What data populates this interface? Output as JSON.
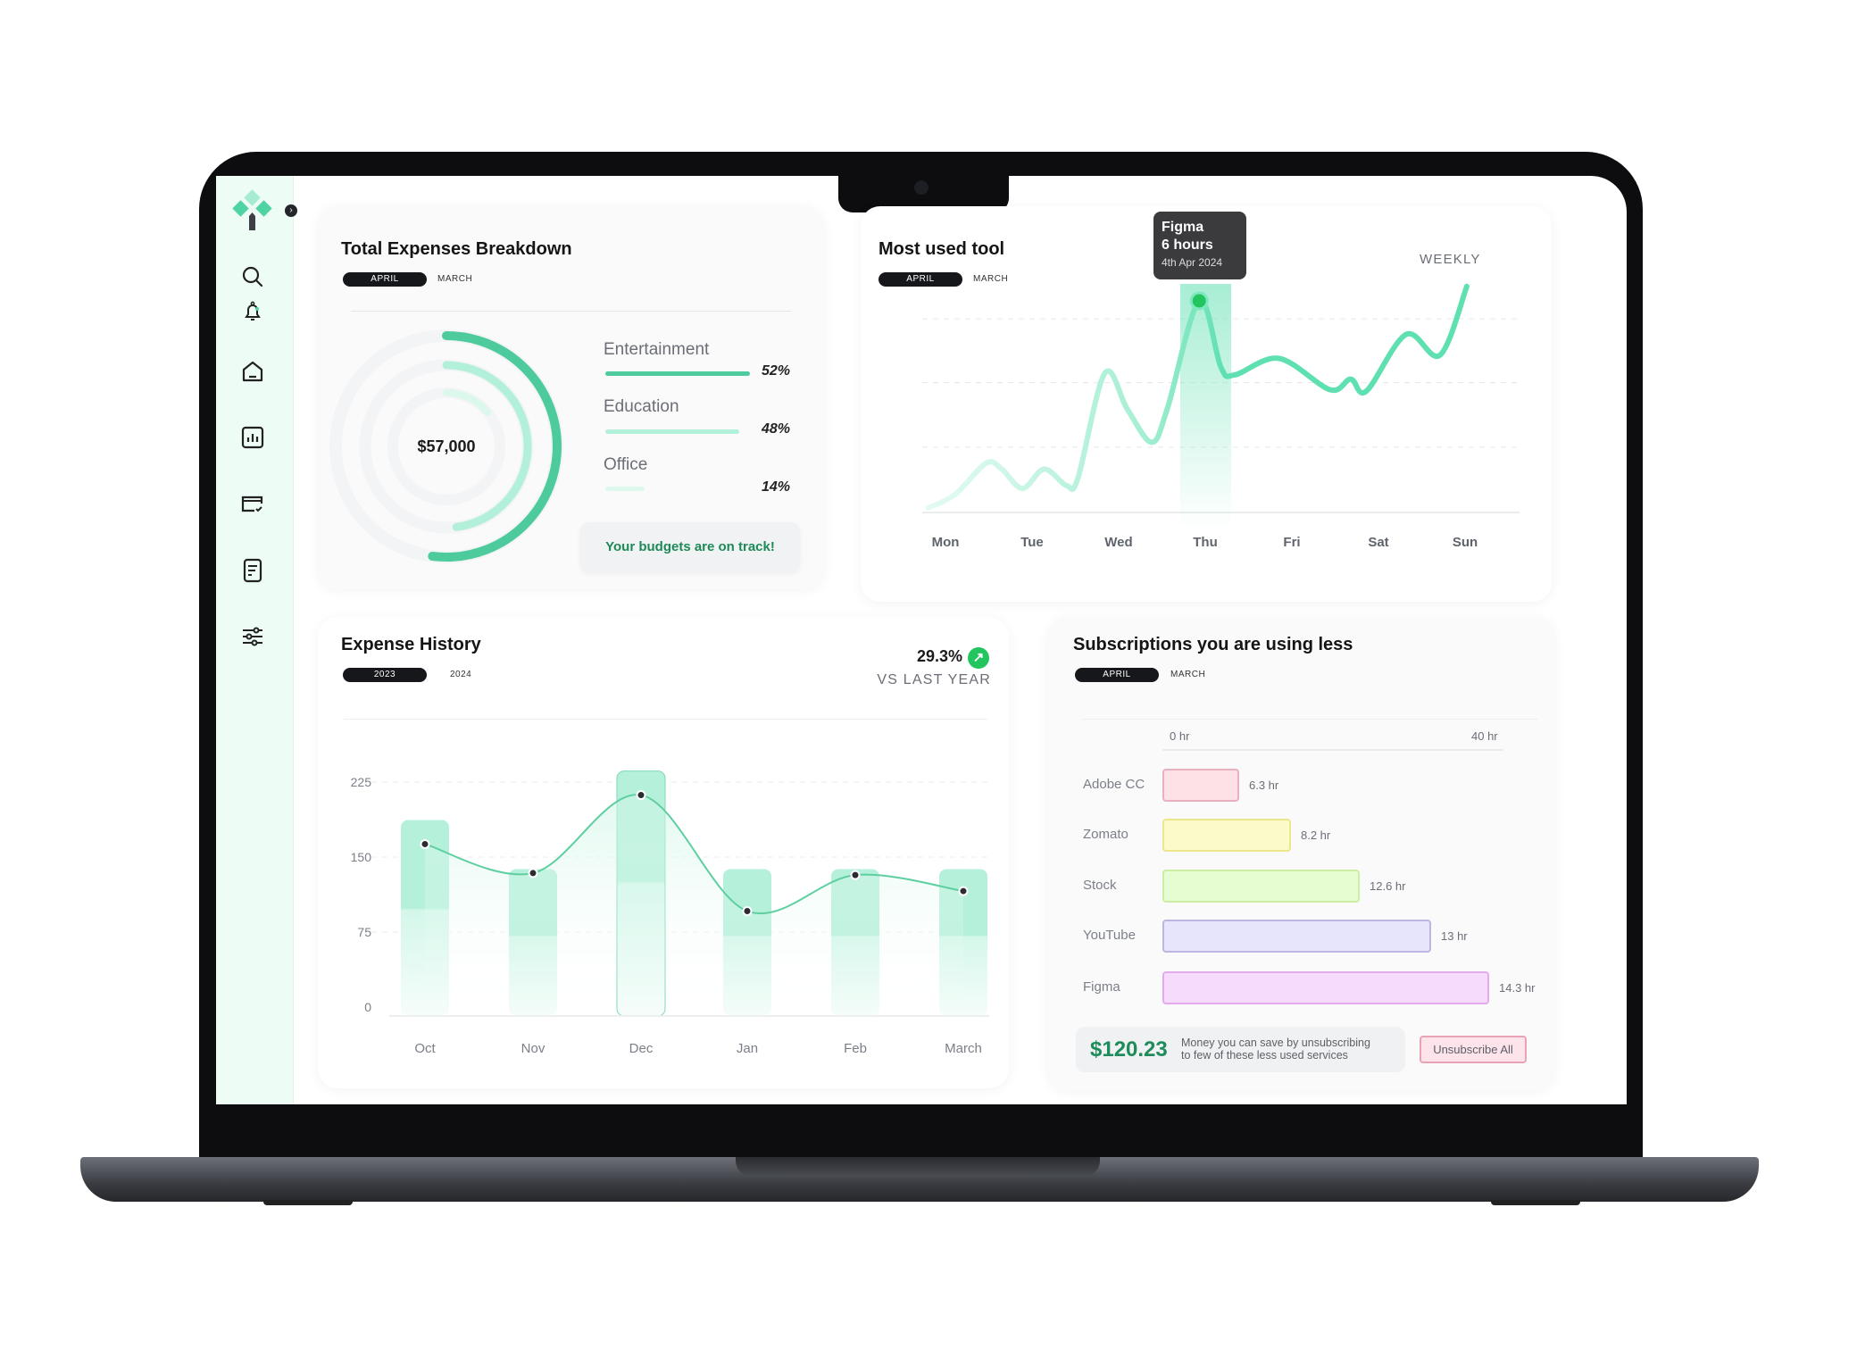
{
  "sidebar": {
    "items": [
      {
        "icon": "search-icon"
      },
      {
        "icon": "bell-icon"
      },
      {
        "icon": "home-icon"
      },
      {
        "icon": "bar-chart-icon"
      },
      {
        "icon": "card-check-icon"
      },
      {
        "icon": "document-icon"
      },
      {
        "icon": "sliders-icon"
      }
    ]
  },
  "expenses_breakdown": {
    "title": "Total Expenses Breakdown",
    "tabs": [
      "APRIL",
      "MARCH"
    ],
    "total": "$57,000",
    "categories": [
      {
        "label": "Entertainment",
        "percent": 52,
        "percent_label": "52%",
        "color": "#4ecb9d"
      },
      {
        "label": "Education",
        "percent": 48,
        "percent_label": "48%",
        "color": "#b3f0da"
      },
      {
        "label": "Office",
        "percent": 14,
        "percent_label": "14%",
        "color": "#dcf8ec"
      }
    ],
    "status": "Your budgets are on track!"
  },
  "most_used_tool": {
    "title": "Most used tool",
    "tabs": [
      "APRIL",
      "MARCH"
    ],
    "period": "WEEKLY",
    "tooltip": {
      "tool": "Figma",
      "value": "6 hours",
      "date": "4th Apr 2024"
    },
    "chart_data": {
      "type": "line",
      "categories": [
        "Mon",
        "Tue",
        "Wed",
        "Thu",
        "Fri",
        "Sat",
        "Sun"
      ],
      "highlight": "Thu",
      "unit": "hours",
      "points": [
        [
          -0.2,
          0.13
        ],
        [
          0.11,
          0.51
        ],
        [
          0.47,
          1.4
        ],
        [
          0.65,
          1.23
        ],
        [
          0.89,
          0.68
        ],
        [
          1.14,
          1.23
        ],
        [
          1.4,
          0.76
        ],
        [
          1.53,
          0.98
        ],
        [
          1.84,
          3.95
        ],
        [
          2.1,
          2.93
        ],
        [
          2.38,
          1.99
        ],
        [
          2.56,
          2.93
        ],
        [
          2.93,
          6.0
        ],
        [
          3.18,
          4.12
        ],
        [
          3.34,
          3.9
        ],
        [
          3.85,
          4.37
        ],
        [
          4.44,
          3.48
        ],
        [
          4.68,
          3.78
        ],
        [
          4.86,
          3.44
        ],
        [
          5.32,
          5.05
        ],
        [
          5.71,
          4.46
        ],
        [
          6.02,
          6.41
        ]
      ],
      "color": "#5fe0b0"
    }
  },
  "expense_history": {
    "title": "Expense History",
    "tabs": [
      "2023",
      "2024"
    ],
    "change": "29.3%",
    "change_label": "VS LAST YEAR",
    "change_color": "#22c55e",
    "chart_data": {
      "type": "bar+line",
      "categories": [
        "Oct",
        "Nov",
        "Dec",
        "Jan",
        "Feb",
        "March"
      ],
      "y_ticks": [
        225,
        150,
        75,
        0
      ],
      "bar_values": [
        187,
        138,
        236,
        138,
        138,
        138
      ],
      "line_values": [
        163,
        134,
        212,
        96,
        132,
        116
      ],
      "highlight": "Dec",
      "bar_color": "#b5f0da",
      "line_color": "#5fcf9f"
    }
  },
  "subscriptions": {
    "title": "Subscriptions you are using less",
    "tabs": [
      "APRIL",
      "MARCH"
    ],
    "chart_data": {
      "type": "bar",
      "orientation": "horizontal",
      "axis_labels": [
        "0 hr",
        "40 hr"
      ],
      "items": [
        {
          "label": "Adobe CC",
          "value": 6.3,
          "value_label": "6.3 hr",
          "fill": "#fde1e7",
          "border": "#eab0bf"
        },
        {
          "label": "Zomato",
          "value": 8.2,
          "value_label": "8.2 hr",
          "fill": "#fdfac9",
          "border": "#ece68f"
        },
        {
          "label": "Stock",
          "value": 12.6,
          "value_label": "12.6 hr",
          "fill": "#e6fcd1",
          "border": "#cbeea4"
        },
        {
          "label": "YouTube",
          "value": 13,
          "value_label": "13 hr",
          "fill": "#e7e5fc",
          "border": "#bbb7e2"
        },
        {
          "label": "Figma",
          "value": 14.3,
          "value_label": "14.3 hr",
          "fill": "#f7dbfc",
          "border": "#e3abec"
        }
      ]
    },
    "savings": {
      "amount": "$120.23",
      "text_line1": "Money you can save by unsubscribing",
      "text_line2": "to few of these less used services"
    },
    "unsubscribe_label": "Unsubscribe All"
  }
}
